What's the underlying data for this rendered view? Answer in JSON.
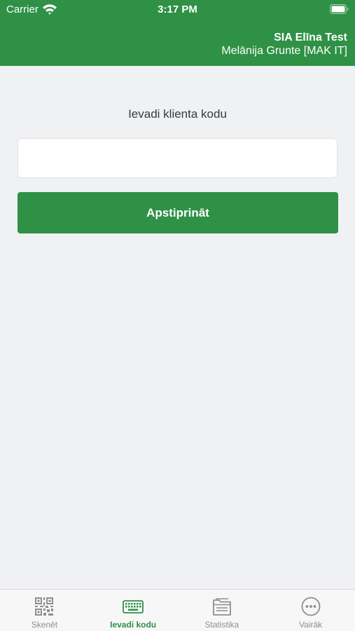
{
  "status_bar": {
    "carrier": "Carrier",
    "time": "3:17 PM"
  },
  "header": {
    "company": "SIA Elīna Test",
    "user": "Melānija Grunte [MAK IT]"
  },
  "main": {
    "prompt": "Ievadi klienta kodu",
    "input_value": "",
    "confirm_label": "Apstiprināt"
  },
  "tabs": [
    {
      "label": "Skenēt",
      "icon": "qr-code-icon",
      "active": false
    },
    {
      "label": "Ievadi kodu",
      "icon": "keyboard-icon",
      "active": true
    },
    {
      "label": "Statistika",
      "icon": "folder-icon",
      "active": false
    },
    {
      "label": "Vairāk",
      "icon": "more-icon",
      "active": false
    }
  ],
  "colors": {
    "brand": "#2e9145",
    "background": "#f0f1f3",
    "tab_inactive": "#8e8e93"
  }
}
